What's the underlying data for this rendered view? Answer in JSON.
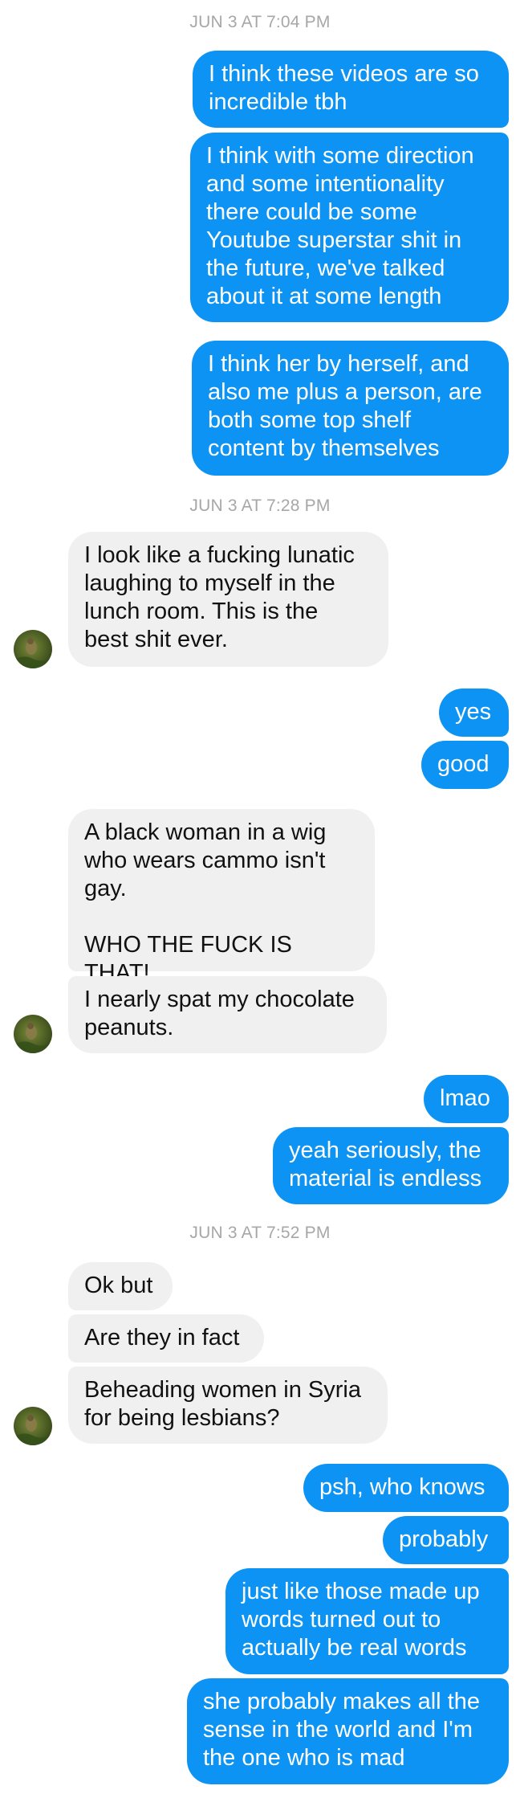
{
  "timestamps": [
    "JUN 3 AT 7:04 PM",
    "JUN 3 AT 7:28 PM",
    "JUN 3 AT 7:52 PM"
  ],
  "messages": {
    "m1": "I think these videos are so\nincredible tbh",
    "m2": "I think with some direction\nand some intentionality\nthere could be some\nYoutube superstar shit in\nthe future, we've talked\nabout it at some length",
    "m3": "I think her by herself, and\nalso me plus a person, are\nboth some top shelf\ncontent by themselves",
    "m4": "I look like a fucking lunatic\nlaughing to myself in the\nlunch room. This is the\nbest shit ever.",
    "m5": "yes",
    "m6": "good",
    "m7": "A black woman in a wig\nwho wears cammo isn't\ngay.\n\nWHO THE FUCK IS THAT!",
    "m8": "I nearly spat my chocolate\npeanuts.",
    "m9": "lmao",
    "m10": "yeah seriously, the\nmaterial is endless",
    "m11": "Ok but",
    "m12": "Are they in fact",
    "m13": "Beheading women in Syria\nfor being lesbians?",
    "m14": "psh, who knows",
    "m15": "probably",
    "m16": "just like those made up\nwords turned out to\nactually be real words",
    "m17": "she probably makes all the\nsense in the world and I'm\nthe one who is mad"
  },
  "colors": {
    "sent_bubble": "#0d93f3",
    "received_bubble": "#f0f0f0",
    "timestamp": "#a7a7a7"
  },
  "icons": {
    "avatar": "contact-avatar-photo"
  }
}
